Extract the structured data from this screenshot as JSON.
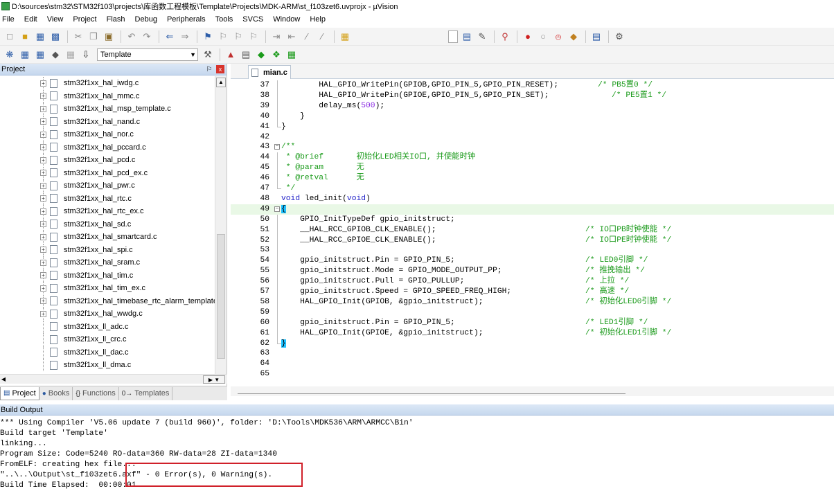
{
  "window": {
    "title": "D:\\sources\\stm32\\STM32f103\\projects\\库函数工程模板\\Template\\Projects\\MDK-ARM\\st_f103zet6.uvprojx - µVision"
  },
  "menu": [
    "File",
    "Edit",
    "View",
    "Project",
    "Flash",
    "Debug",
    "Peripherals",
    "Tools",
    "SVCS",
    "Window",
    "Help"
  ],
  "toolbar2": {
    "target": "Template"
  },
  "project_panel": {
    "title": "Project",
    "pin": "⚐",
    "close": "x",
    "files": [
      "stm32f1xx_hal_iwdg.c",
      "stm32f1xx_hal_mmc.c",
      "stm32f1xx_hal_msp_template.c",
      "stm32f1xx_hal_nand.c",
      "stm32f1xx_hal_nor.c",
      "stm32f1xx_hal_pccard.c",
      "stm32f1xx_hal_pcd.c",
      "stm32f1xx_hal_pcd_ex.c",
      "stm32f1xx_hal_pwr.c",
      "stm32f1xx_hal_rtc.c",
      "stm32f1xx_hal_rtc_ex.c",
      "stm32f1xx_hal_sd.c",
      "stm32f1xx_hal_smartcard.c",
      "stm32f1xx_hal_spi.c",
      "stm32f1xx_hal_sram.c",
      "stm32f1xx_hal_tim.c",
      "stm32f1xx_hal_tim_ex.c",
      "stm32f1xx_hal_timebase_rtc_alarm_template",
      "stm32f1xx_hal_wwdg.c",
      "stm32f1xx_ll_adc.c",
      "stm32f1xx_ll_crc.c",
      "stm32f1xx_ll_dac.c",
      "stm32f1xx_ll_dma.c"
    ],
    "tabs": [
      {
        "label": "Project",
        "icon": "project-icon"
      },
      {
        "label": "Books",
        "icon": "books-icon"
      },
      {
        "label": "Functions",
        "icon": "functions-icon"
      },
      {
        "label": "Templates",
        "icon": "templates-icon"
      }
    ]
  },
  "editor": {
    "active_tab": "mian.c",
    "lines": [
      {
        "n": "37",
        "code": "        HAL_GPIO_WritePin(GPIOB,GPIO_PIN_5,GPIO_PIN_RESET);",
        "comment": "/* PB5置0 */"
      },
      {
        "n": "38",
        "code": "        HAL_GPIO_WritePin(GPIOE,GPIO_PIN_5,GPIO_PIN_SET);",
        "comment": "/* PE5置1 */"
      },
      {
        "n": "39",
        "code": "        delay_ms(500);",
        "comment": ""
      },
      {
        "n": "40",
        "code": "    }",
        "comment": ""
      },
      {
        "n": "41",
        "code": "}",
        "comment": ""
      },
      {
        "n": "42",
        "code": "",
        "comment": ""
      },
      {
        "n": "43",
        "code": "/**",
        "comment": ""
      },
      {
        "n": "44",
        "code": " * @brief       初始化LED相关IO口, 并使能时钟",
        "comment": ""
      },
      {
        "n": "45",
        "code": " * @param       无",
        "comment": ""
      },
      {
        "n": "46",
        "code": " * @retval      无",
        "comment": ""
      },
      {
        "n": "47",
        "code": " */",
        "comment": ""
      },
      {
        "n": "48",
        "code": "void led_init(void)",
        "comment": ""
      },
      {
        "n": "49",
        "code": "{",
        "comment": ""
      },
      {
        "n": "50",
        "code": "    GPIO_InitTypeDef gpio_initstruct;",
        "comment": ""
      },
      {
        "n": "51",
        "code": "    __HAL_RCC_GPIOB_CLK_ENABLE();",
        "comment": "/* IO口PB时钟使能 */"
      },
      {
        "n": "52",
        "code": "    __HAL_RCC_GPIOE_CLK_ENABLE();",
        "comment": "/* IO口PE时钟使能 */"
      },
      {
        "n": "53",
        "code": "",
        "comment": ""
      },
      {
        "n": "54",
        "code": "    gpio_initstruct.Pin = GPIO_PIN_5;",
        "comment": "/* LED0引脚 */"
      },
      {
        "n": "55",
        "code": "    gpio_initstruct.Mode = GPIO_MODE_OUTPUT_PP;",
        "comment": "/* 推挽输出 */"
      },
      {
        "n": "56",
        "code": "    gpio_initstruct.Pull = GPIO_PULLUP;",
        "comment": "/* 上拉 */"
      },
      {
        "n": "57",
        "code": "    gpio_initstruct.Speed = GPIO_SPEED_FREQ_HIGH;",
        "comment": "/* 高速 */"
      },
      {
        "n": "58",
        "code": "    HAL_GPIO_Init(GPIOB, &gpio_initstruct);",
        "comment": "/* 初始化LED0引脚 */"
      },
      {
        "n": "59",
        "code": "",
        "comment": ""
      },
      {
        "n": "60",
        "code": "    gpio_initstruct.Pin = GPIO_PIN_5;",
        "comment": "/* LED1引脚 */"
      },
      {
        "n": "61",
        "code": "    HAL_GPIO_Init(GPIOE, &gpio_initstruct);",
        "comment": "/* 初始化LED1引脚 */"
      },
      {
        "n": "62",
        "code": "}",
        "comment": ""
      },
      {
        "n": "63",
        "code": "",
        "comment": ""
      },
      {
        "n": "64",
        "code": "",
        "comment": ""
      },
      {
        "n": "65",
        "code": "",
        "comment": ""
      }
    ]
  },
  "build_output": {
    "title": "Build Output",
    "lines": [
      "*** Using Compiler 'V5.06 update 7 (build 960)', folder: 'D:\\Tools\\MDK536\\ARM\\ARMCC\\Bin'",
      "Build target 'Template'",
      "linking...",
      "Program Size: Code=5240 RO-data=360 RW-data=28 ZI-data=1340",
      "FromELF: creating hex file...",
      "\"..\\..\\Output\\st_f103zet6.axf\" - 0 Error(s), 0 Warning(s).",
      "Build Time Elapsed:  00:00:01"
    ]
  },
  "colors": {
    "comment": "#1a9a1a",
    "keyword": "#2020c8",
    "highlight_box": "#d0202a",
    "brace_highlight": "#1ec0ff"
  }
}
